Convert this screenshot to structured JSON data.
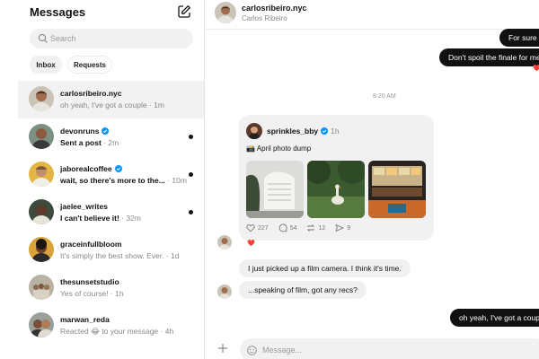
{
  "sidebar": {
    "title": "Messages",
    "search_placeholder": "Search",
    "filters": [
      "Inbox",
      "Requests"
    ],
    "conversations": [
      {
        "name": "carlosribeiro.nyc",
        "preview": "oh yeah, I've got a couple",
        "time": "1m",
        "verified": false,
        "unread": false,
        "active": true
      },
      {
        "name": "devonruns",
        "preview": "Sent a post",
        "time": "2m",
        "verified": true,
        "unread": true,
        "active": false
      },
      {
        "name": "jaborealcoffee",
        "preview": "wait, so there's more to the...",
        "time": "10m",
        "verified": true,
        "unread": true,
        "active": false
      },
      {
        "name": "jaelee_writes",
        "preview": "I can't believe it!",
        "time": "32m",
        "verified": false,
        "unread": true,
        "active": false
      },
      {
        "name": "graceinfullbloom",
        "preview": "It's simply the best show. Ever.",
        "time": "1d",
        "verified": false,
        "unread": false,
        "active": false
      },
      {
        "name": "thesunsetstudio",
        "preview": "Yes of course!",
        "time": "1h",
        "verified": false,
        "unread": false,
        "active": false
      },
      {
        "name": "marwan_reda",
        "preview": "Reacted 😂 to your message",
        "time": "4h",
        "verified": false,
        "unread": false,
        "active": false
      }
    ]
  },
  "chat": {
    "header": {
      "username": "carlosribeiro.nyc",
      "fullname": "Carlos Ribeiro"
    },
    "messages": {
      "out1": "For sure 😊",
      "out2": "Don't spoil the finale for me",
      "timestamp": "8:20 AM",
      "in1": "I just picked up a film camera. I think it's time.",
      "in2": "...speaking of film, got any recs?",
      "out3": "oh yeah, I've got a couple"
    },
    "shared_post": {
      "author": "sprinkles_bby",
      "time": "1h",
      "caption": "📸 April photo dump",
      "likes": "227",
      "comments": "54",
      "reposts": "12",
      "shares": "9"
    },
    "reaction": "❤️",
    "composer_placeholder": "Message..."
  },
  "colors": {
    "outgoing_bubble": "#111111",
    "incoming_bubble": "#f0f0f0",
    "verified": "#0095f6",
    "heart": "#e3223b"
  }
}
